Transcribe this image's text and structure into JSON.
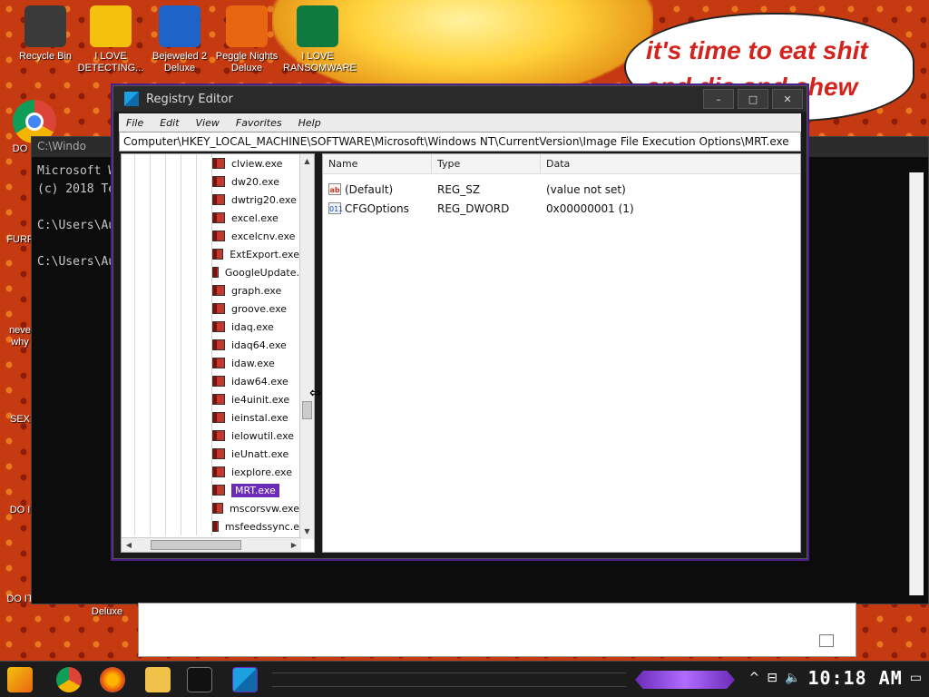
{
  "desktop": {
    "speech_text": "it's time to eat shit and die and chew",
    "icons": [
      {
        "label": "Recycle Bin",
        "icon": "recycle-bin-icon",
        "color": "#3a3a3a"
      },
      {
        "label": "I LOVE DETECTING...",
        "icon": "de-app-icon",
        "color": "#f4c20d"
      },
      {
        "label": "Bejeweled 2 Deluxe",
        "icon": "bejeweled-icon",
        "color": "#1e63c8"
      },
      {
        "label": "Peggle Nights Deluxe",
        "icon": "peggle-icon",
        "color": "#e8660f"
      },
      {
        "label": "I LOVE RANSOMWARE",
        "icon": "publisher-icon",
        "color": "#0f7a3e"
      }
    ],
    "left_labels": [
      "DO",
      "FURF",
      "neve why",
      "SEX",
      "DO I",
      "DO IT"
    ],
    "deluxe_label": "Deluxe"
  },
  "cmd": {
    "title": "C:\\Windo",
    "lines": [
      "Microsoft W",
      "(c) 2018 Te",
      "",
      "C:\\Users\\Au",
      "",
      "C:\\Users\\Au"
    ]
  },
  "regedit": {
    "title": "Registry Editor",
    "menu": [
      "File",
      "Edit",
      "View",
      "Favorites",
      "Help"
    ],
    "address": "Computer\\HKEY_LOCAL_MACHINE\\SOFTWARE\\Microsoft\\Windows NT\\CurrentVersion\\Image File Execution Options\\MRT.exe",
    "tree": [
      "clview.exe",
      "dw20.exe",
      "dwtrig20.exe",
      "excel.exe",
      "excelcnv.exe",
      "ExtExport.exe",
      "GoogleUpdate.",
      "graph.exe",
      "groove.exe",
      "idaq.exe",
      "idaq64.exe",
      "idaw.exe",
      "idaw64.exe",
      "ie4uinit.exe",
      "ieinstal.exe",
      "ielowutil.exe",
      "ieUnatt.exe",
      "iexplore.exe",
      "MRT.exe",
      "mscorsvw.exe",
      "msfeedssync.e"
    ],
    "selected": "MRT.exe",
    "columns": [
      "Name",
      "Type",
      "Data"
    ],
    "values": [
      {
        "name": "(Default)",
        "type": "REG_SZ",
        "data": "(value not set)",
        "icon": "ab"
      },
      {
        "name": "CFGOptions",
        "type": "REG_DWORD",
        "data": "0x00000001 (1)",
        "icon": "011"
      }
    ],
    "window_buttons": [
      "–",
      "□",
      "✕"
    ]
  },
  "taskbar": {
    "clock": "10:18 AM"
  }
}
